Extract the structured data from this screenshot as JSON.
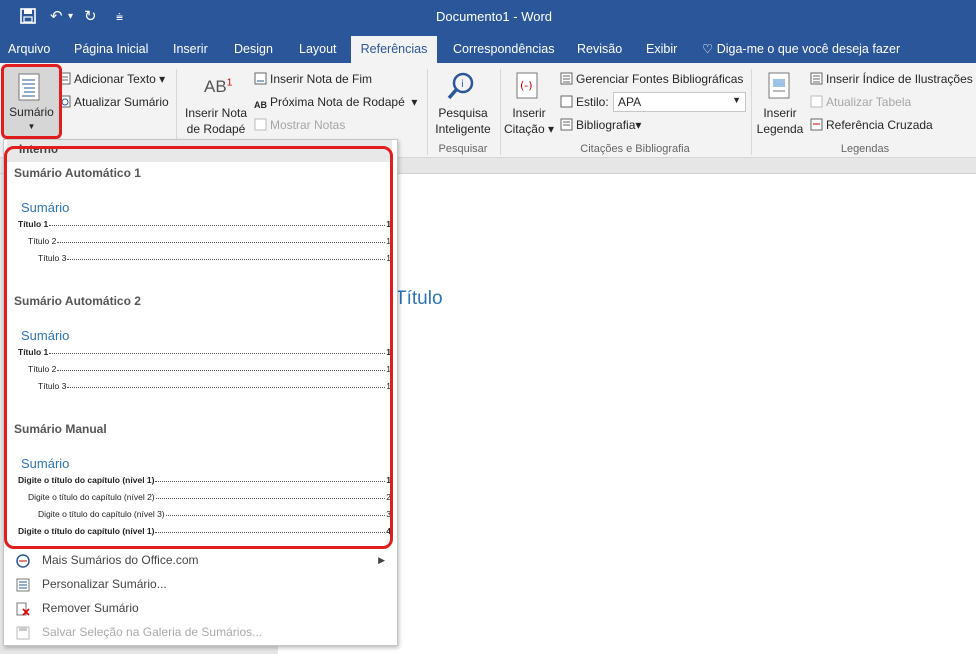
{
  "window": {
    "title": "Documento1  -  Word"
  },
  "quick_access": {
    "save_icon": "save-icon",
    "undo_icon": "undo-icon",
    "redo_icon": "redo-icon",
    "customize_icon": "customize-icon"
  },
  "tabs": [
    {
      "label": "Arquivo"
    },
    {
      "label": "Página Inicial"
    },
    {
      "label": "Inserir"
    },
    {
      "label": "Design"
    },
    {
      "label": "Layout"
    },
    {
      "label": "Referências"
    },
    {
      "label": "Correspondências"
    },
    {
      "label": "Revisão"
    },
    {
      "label": "Exibir"
    }
  ],
  "tell_me": "Diga-me o que você deseja fazer",
  "ribbon": {
    "sumario": "Sumário",
    "adicionar_texto": "Adicionar Texto",
    "atualizar_sumario": "Atualizar Sumário",
    "inserir_nota_1": "Inserir Nota",
    "inserir_nota_2": "de Rodapé",
    "inserir_nota_fim": "Inserir Nota de Fim",
    "proxima_nota": "Próxima Nota de Rodapé",
    "mostrar_notas": "Mostrar Notas",
    "pesquisa_1": "Pesquisa",
    "pesquisa_2": "Inteligente",
    "grp_pesquisar": "Pesquisar",
    "inserir_citacao_1": "Inserir",
    "inserir_citacao_2": "Citação",
    "gerenciar_fontes": "Gerenciar Fontes Bibliográficas",
    "estilo_label": "Estilo:",
    "estilo_value": "APA",
    "bibliografia": "Bibliografia",
    "grp_citacoes": "Citações e Bibliografia",
    "inserir_legenda_1": "Inserir",
    "inserir_legenda_2": "Legenda",
    "inserir_indice": "Inserir Índice de Ilustrações",
    "atualizar_tabela": "Atualizar Tabela",
    "referencia_cruzada": "Referência Cruzada",
    "grp_legendas": "Legendas",
    "ab_icon_text": "AB",
    "ab_sup": "1",
    "ab_small": "AB"
  },
  "document": {
    "titulo": "Título"
  },
  "dropdown": {
    "header": "Interno",
    "sections": [
      {
        "title": "Sumário Automático 1",
        "heading": "Sumário",
        "lines": [
          {
            "text": "Título 1",
            "page": "1"
          },
          {
            "text": "Título 2",
            "page": "1"
          },
          {
            "text": "Título 3",
            "page": "1"
          }
        ]
      },
      {
        "title": "Sumário Automático 2",
        "heading": "Sumário",
        "lines": [
          {
            "text": "Título 1",
            "page": "1"
          },
          {
            "text": "Título 2",
            "page": "1"
          },
          {
            "text": "Título 3",
            "page": "1"
          }
        ]
      },
      {
        "title": "Sumário Manual",
        "heading": "Sumário",
        "lines": [
          {
            "text": "Digite o título do capítulo (nível 1)",
            "page": "1"
          },
          {
            "text": "Digite o título do capítulo (nível 2)",
            "page": "2"
          },
          {
            "text": "Digite o título do capítulo (nível 3)",
            "page": "3"
          },
          {
            "text": "Digite o título do capítulo (nível 1)",
            "page": "4"
          }
        ]
      }
    ],
    "menu": [
      {
        "label": "Mais Sumários do Office.com",
        "icon": "office-icon"
      },
      {
        "label": "Personalizar Sumário...",
        "icon": "customize-toc-icon"
      },
      {
        "label": "Remover Sumário",
        "icon": "remove-toc-icon"
      },
      {
        "label": "Salvar Seleção na Galeria de Sumários...",
        "icon": "save-gallery-icon"
      }
    ]
  },
  "colors": {
    "accent": "#2b579a",
    "highlight": "#e21d1d",
    "toc_heading": "#2e74b5"
  }
}
